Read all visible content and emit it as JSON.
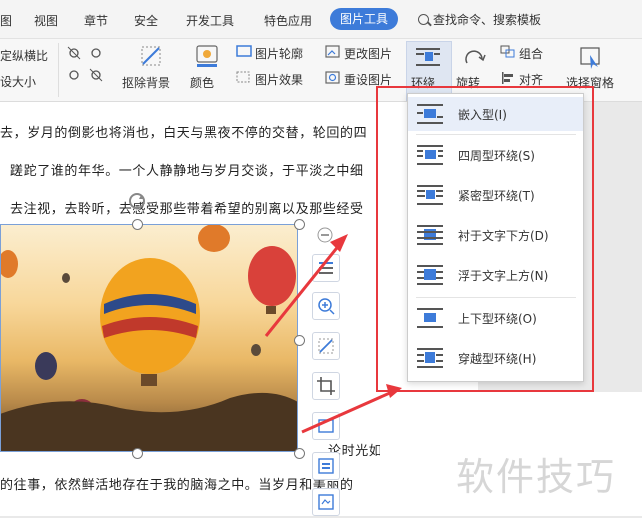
{
  "menubar": {
    "tabs": [
      "图",
      "视图",
      "章节",
      "安全",
      "开发工具",
      "特色应用"
    ],
    "active_tab": "图片工具",
    "search_label": "查找命令、搜索模板"
  },
  "ribbon": {
    "lock_ratio": "定纵横比",
    "reset_size": "设大小",
    "remove_bg": "抠除背景",
    "color": "颜色",
    "outline": "图片轮廓",
    "effect": "图片效果",
    "change_pic": "更改图片",
    "reset_pic": "重设图片",
    "wrap": "环绕",
    "rotate": "旋转",
    "group": "组合",
    "align": "对齐",
    "selection_pane": "选择窗格"
  },
  "document": {
    "lines": [
      "去，岁月的倒影也将消也，白天与黑夜不停的交替，轮回的四",
      "蹉跎了谁的年华。一个人静静地与岁月交谈，于平淡之中细",
      "去注视，去聆听，去感受那些带着希望的别离以及那些经受"
    ],
    "line_after_img_tail": "论时光如何",
    "lines_bottom": [
      "的往事，依然鲜活地存在于我的脑海之中。当岁月和美丽的"
    ]
  },
  "wrap_menu": {
    "items": [
      "嵌入型(I)",
      "四周型环绕(S)",
      "紧密型环绕(T)",
      "衬于文字下方(D)",
      "浮于文字上方(N)",
      "上下型环绕(O)",
      "穿越型环绕(H)"
    ]
  },
  "watermark": "软件技巧",
  "colors": {
    "accent": "#3d7bd9",
    "annotation_red": "#e8383d"
  }
}
